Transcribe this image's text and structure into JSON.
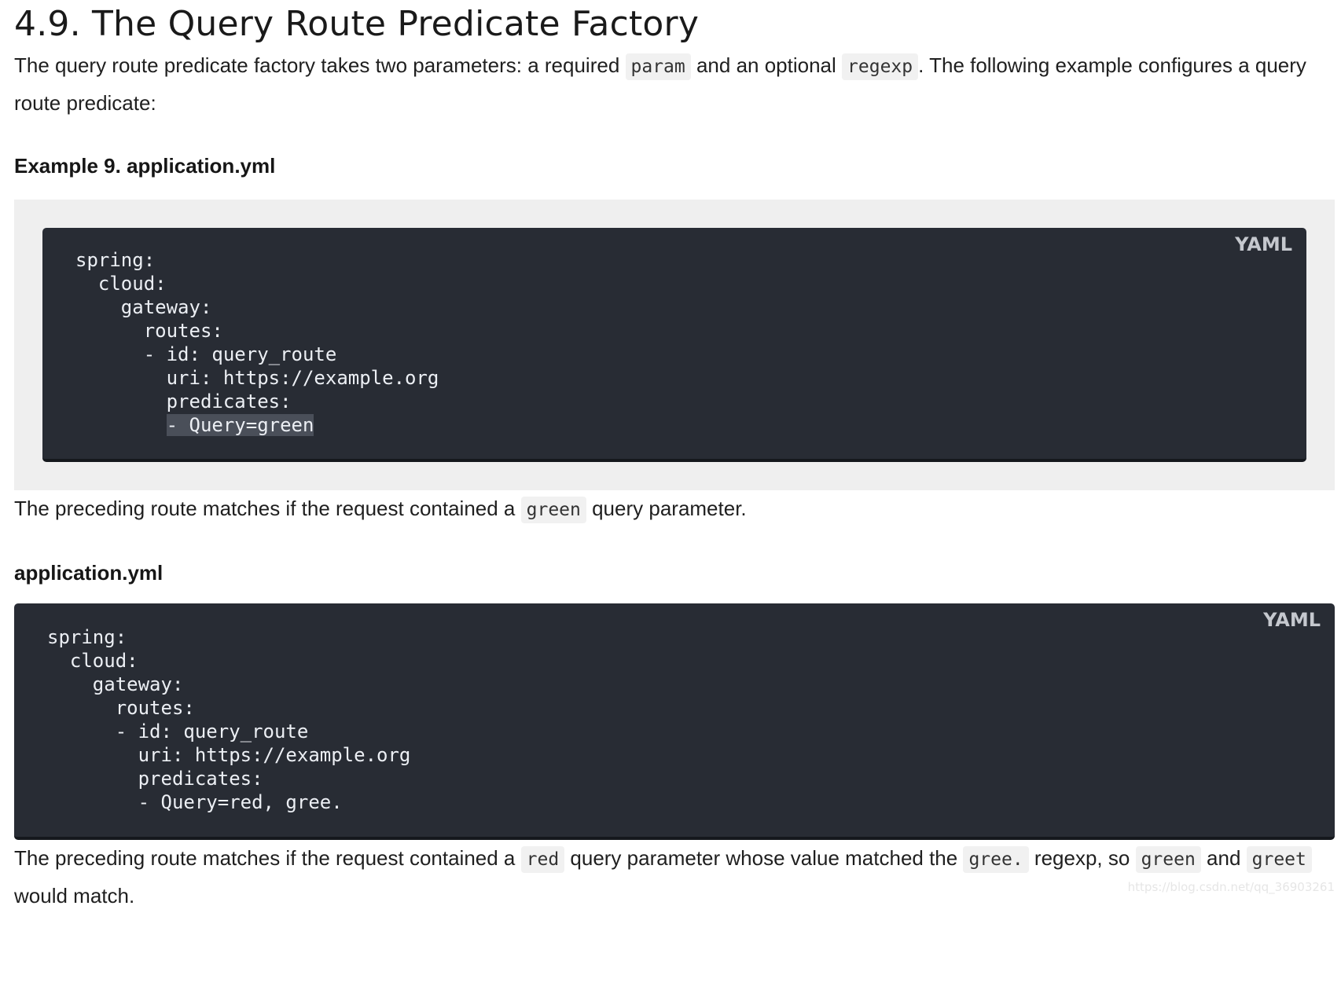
{
  "title": "4.9. The Query Route Predicate Factory",
  "intro": {
    "t1": "The query route predicate factory takes two parameters: a required ",
    "c1": "param",
    "t2": " and an optional ",
    "c2": "regexp",
    "t3": ". The following example configures a query route predicate:"
  },
  "example1": {
    "caption": "Example 9. application.yml",
    "lang": "YAML",
    "code_main": "spring:\n  cloud:\n    gateway:\n      routes:\n      - id: query_route\n        uri: https://example.org\n        predicates:\n",
    "code_indent": "        ",
    "code_highlight": "- Query=green"
  },
  "para2": {
    "t1": "The preceding route matches if the request contained a ",
    "c1": "green",
    "t2": " query parameter."
  },
  "example2": {
    "caption": "application.yml",
    "lang": "YAML",
    "code": "spring:\n  cloud:\n    gateway:\n      routes:\n      - id: query_route\n        uri: https://example.org\n        predicates:\n        - Query=red, gree."
  },
  "para3": {
    "t1": "The preceding route matches if the request contained a ",
    "c1": "red",
    "t2": " query parameter whose value matched the ",
    "c2": "gree.",
    "t3": " regexp, so ",
    "c3": "green",
    "t4": " and ",
    "c4": "greet",
    "t5": " would match."
  },
  "watermark": "https://blog.csdn.net/qq_36903261"
}
